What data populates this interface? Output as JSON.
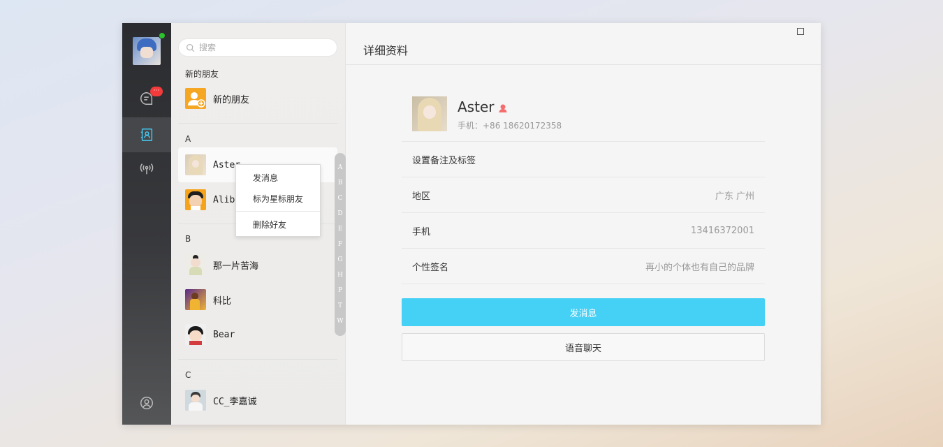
{
  "nav": {
    "chat_badge": "···",
    "icons": [
      "chat-icon",
      "contacts-icon",
      "broadcast-icon",
      "profile-icon"
    ]
  },
  "search": {
    "placeholder": "搜索"
  },
  "contacts": {
    "new_friends_section": "新的朋友",
    "new_friends_item": "新的朋友",
    "sections": [
      {
        "letter": "A",
        "items": [
          "Aster",
          "Aliba"
        ]
      },
      {
        "letter": "B",
        "items": [
          "那一片苦海",
          "科比",
          "Bear"
        ]
      },
      {
        "letter": "C",
        "items": [
          "CC_李嘉诚"
        ]
      }
    ],
    "alphabet": [
      "A",
      "B",
      "C",
      "D",
      "E",
      "F",
      "G",
      "H",
      "P",
      "T",
      "W"
    ]
  },
  "context_menu": {
    "send_message": "发消息",
    "star_friend": "标为星标朋友",
    "delete_friend": "删除好友"
  },
  "detail": {
    "title": "详细资料",
    "name": "Aster",
    "phone_line": "手机：+86 18620172358",
    "rows": [
      {
        "label": "设置备注及标签",
        "value": ""
      },
      {
        "label": "地区",
        "value": "广东 广州"
      },
      {
        "label": "手机",
        "value": "13416372001"
      },
      {
        "label": "个性签名",
        "value": "再小的个体也有自己的品牌"
      }
    ],
    "send_button": "发消息",
    "voice_button": "语音聊天"
  },
  "colors": {
    "accent": "#45d0f5",
    "online": "#2dc12d",
    "badge": "#f43b3b",
    "new_friend_icon": "#f5a623",
    "gender_icon": "#f56c6c"
  }
}
